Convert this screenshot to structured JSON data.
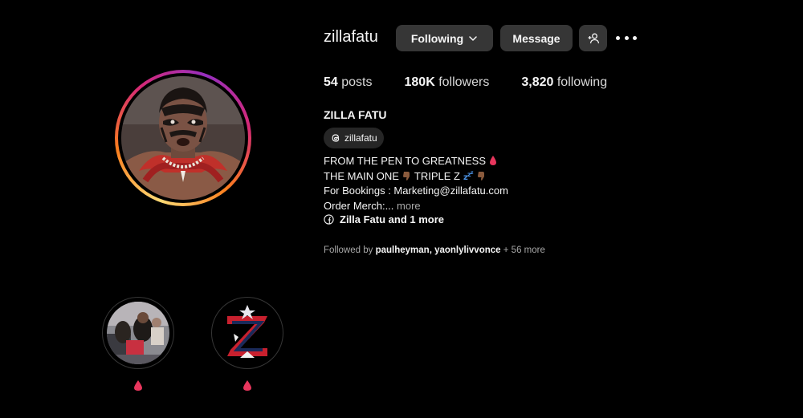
{
  "profile": {
    "username": "zillafatu",
    "full_name": "ZILLA FATU",
    "threads_handle": "zillafatu"
  },
  "actions": {
    "following_label": "Following",
    "message_label": "Message"
  },
  "stats": {
    "posts_count": "54",
    "posts_label": "posts",
    "followers_count": "180K",
    "followers_label": "followers",
    "following_count": "3,820",
    "following_label": "following"
  },
  "bio": {
    "line1": "FROM THE PEN TO GREATNESS",
    "line2a": "THE MAIN ONE",
    "line2b": "TRIPLE Z",
    "line3": "For Bookings : Marketing@zillafatu.com",
    "line4": "Order Merch:...",
    "more_label": "more",
    "link_text": "Zilla Fatu and 1 more"
  },
  "followed_by": {
    "prefix": "Followed by",
    "user1": "paulheyman",
    "separator": ",",
    "user2": "yaonlylivvonce",
    "suffix": "+ 56 more"
  },
  "highlights": [
    {
      "icon": "blood-drop-icon"
    },
    {
      "icon": "blood-drop-icon"
    }
  ],
  "colors": {
    "background": "#000000",
    "button_bg": "#363636",
    "text_primary": "#f5f5f5",
    "text_secondary": "#a8a8a8",
    "drop_pink": "#e8365d"
  }
}
